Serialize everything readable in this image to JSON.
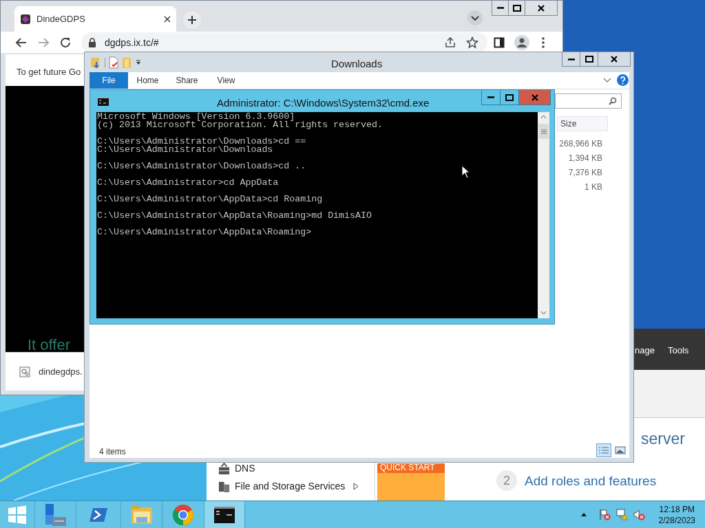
{
  "browser": {
    "tabs": [
      {
        "title": "DindeGDPS",
        "selected": true
      }
    ],
    "address": "dgdps.ix.tc/#",
    "page_text": "To get future Go",
    "banner_text": "It offer",
    "download": "dindegdps."
  },
  "server_manager": {
    "menu": [
      "nage",
      "Tools"
    ],
    "sidebar_items": [
      {
        "label": "DNS",
        "kind": "dns",
        "has_arrow": false
      },
      {
        "label": "File and Storage Services",
        "kind": "storage",
        "has_arrow": true
      }
    ],
    "quick_start": "QUICK START",
    "heading": "server",
    "step": {
      "number": "2",
      "label": "Add roles and features"
    }
  },
  "explorer": {
    "title": "Downloads",
    "ribbon_tabs": [
      {
        "label": "File",
        "selected": true
      },
      {
        "label": "Home",
        "selected": false
      },
      {
        "label": "Share",
        "selected": false
      },
      {
        "label": "View",
        "selected": false
      }
    ],
    "column": "Size",
    "sizes": [
      "268,966 KB",
      "1,394 KB",
      "7,376 KB",
      "1 KB"
    ],
    "status": "4 items",
    "views": [
      {
        "kind": "details",
        "selected": true
      },
      {
        "kind": "thumbnails",
        "selected": false
      }
    ]
  },
  "cmd": {
    "title": "Administrator: C:\\Windows\\System32\\cmd.exe",
    "blocks": [
      [
        "Microsoft Windows [Version 6.3.9600]",
        "(c) 2013 Microsoft Corporation. All rights reserved."
      ],
      [
        "C:\\Users\\Administrator\\Downloads>cd ==",
        "C:\\Users\\Administrator\\Downloads"
      ],
      [
        "C:\\Users\\Administrator\\Downloads>cd .."
      ],
      [
        "C:\\Users\\Administrator>cd AppData"
      ],
      [
        "C:\\Users\\Administrator\\AppData>cd Roaming"
      ],
      [
        "C:\\Users\\Administrator\\AppData\\Roaming>md DimisAIO"
      ],
      [
        "C:\\Users\\Administrator\\AppData\\Roaming>"
      ]
    ]
  },
  "taskbar": {
    "apps": [
      {
        "kind": "start",
        "selected": false
      },
      {
        "kind": "server-manager",
        "selected": false
      },
      {
        "kind": "powershell",
        "selected": false
      },
      {
        "kind": "explorer",
        "selected": false
      },
      {
        "kind": "chrome",
        "selected": false
      },
      {
        "kind": "cmd",
        "selected": true
      }
    ],
    "time": "12:18 PM",
    "date": "2/28/2023"
  }
}
